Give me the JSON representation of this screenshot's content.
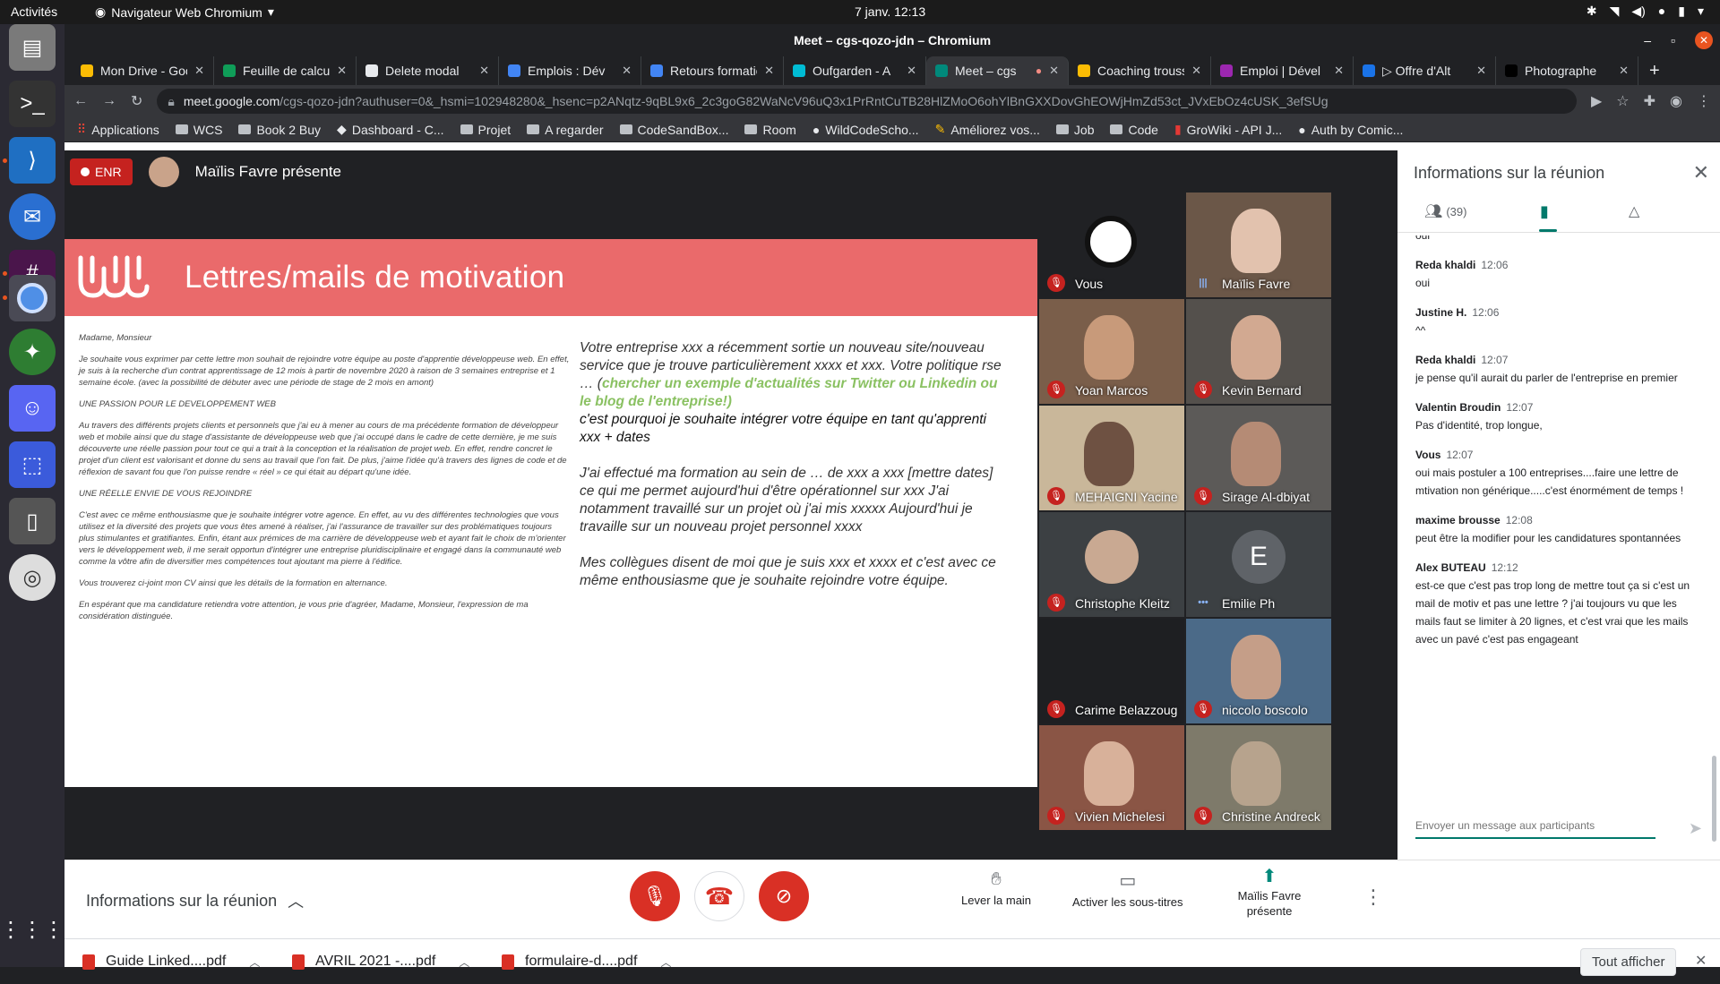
{
  "topbar": {
    "activities": "Activités",
    "app_name": "Navigateur Web Chromium",
    "clock": "7 janv.  12:13"
  },
  "window": {
    "title": "Meet – cgs-qozo-jdn – Chromium"
  },
  "tabs": [
    {
      "label": "Mon Drive - Google",
      "color": "#fbbc04"
    },
    {
      "label": "Feuille de calcul",
      "color": "#0f9d58"
    },
    {
      "label": "Delete modal",
      "color": "#e8eaed"
    },
    {
      "label": "Emplois : Dév",
      "color": "#4285f4"
    },
    {
      "label": "Retours formation",
      "color": "#4285f4"
    },
    {
      "label": "Oufgarden - A",
      "color": "#00bcd4"
    },
    {
      "label": "Meet – cgs",
      "color": "#00897b"
    },
    {
      "label": "Coaching trousse",
      "color": "#fbbc04"
    },
    {
      "label": "Emploi | Dével",
      "color": "#9c27b0"
    },
    {
      "label": "▷ Offre d'Alt",
      "color": "#1a73e8"
    },
    {
      "label": "Photographe",
      "color": "#000000"
    }
  ],
  "address": {
    "host": "meet.google.com",
    "path": "/cgs-qozo-jdn?authuser=0&_hsmi=102948280&_hsenc=p2ANqtz-9qBL9x6_2c3goG82WaNcV96uQ3x1PrRntCuTB28HlZMoO6ohYlBnGXXDovGhEOWjHmZd53ct_JVxEbOz4cUSK_3efSUg"
  },
  "bookmarks": [
    "Applications",
    "WCS",
    "Book 2 Buy",
    "Dashboard - C...",
    "Projet",
    "A regarder",
    "CodeSandBox...",
    "Room",
    "WildCodeScho...",
    "Améliorez vos...",
    "Job",
    "Code",
    "GroWiki - API J...",
    "Auth by Comic..."
  ],
  "recording": {
    "badge": "ENR",
    "presenter": "Maïlis Favre présente"
  },
  "slide": {
    "title": "Lettres/mails de motivation",
    "letter": [
      "Madame, Monsieur",
      "Je souhaite vous exprimer par cette lettre mon souhait de rejoindre votre équipe au poste d'apprentie développeuse web. En effet, je suis à la recherche d'un contrat apprentissage de 12 mois à partir de novembre 2020 à raison de 3 semaines entreprise et 1 semaine école. (avec la possibilité de débuter avec une période de stage de 2 mois en amont)",
      "UNE PASSION POUR LE DEVELOPPEMENT WEB",
      "Au travers des différents projets clients et personnels que j'ai eu à mener au cours de ma précédente formation de développeur web et mobile ainsi que du stage d'assistante de développeuse web que j'ai occupé dans le cadre de cette dernière, je me suis découverte une réelle passion pour tout ce qui a trait à la conception et la réalisation de projet web. En effet, rendre concret le projet d'un client est valorisant et donne du sens au travail que l'on fait. De plus, j'aime l'idée qu'à travers des lignes de code et de réflexion de savant fou que l'on puisse rendre « réel » ce qui était au départ qu'une idée.",
      "UNE RÉELLE ENVIE DE VOUS REJOINDRE",
      "C'est avec ce même enthousiasme que je souhaite intégrer votre agence. En effet, au vu des différentes technologies que vous utilisez et la diversité des projets que vous êtes amené à réaliser, j'ai l'assurance de travailler sur des problématiques toujours plus stimulantes et gratifiantes. Enfin, étant aux prémices de ma carrière de développeuse web et ayant fait le choix de m'orienter vers le développement web, il me serait opportun d'intégrer une entreprise pluridisciplinaire et engagé dans la communauté web comme la vôtre afin de diversifier mes compétences tout ajoutant ma pierre à l'édifice.",
      "Vous trouverez ci-joint mon CV ainsi que les détails de la formation en alternance.",
      "En espérant que ma candidature retiendra votre attention, je vous prie d'agréer, Madame, Monsieur, l'expression de ma considération distinguée."
    ],
    "notes": {
      "p1_a": "Votre entreprise xxx a récemment sortie un nouveau site/nouveau service que je trouve particulièrement xxxx et xxx. Votre politique rse … (",
      "p1_hl": "chercher un exemple d'actualités sur Twitter ou Linkedin ou le blog de l'entreprise!)",
      "p1_b": "c'est pourquoi je souhaite intégrer votre équipe en tant qu'apprenti xxx + dates",
      "p2": "J'ai effectué ma formation au sein de … de xxx a xxx [mettre dates] ce qui me permet aujourd'hui d'être opérationnel sur xxx J'ai notamment travaillé sur un projet où j'ai mis xxxxx Aujourd'hui je travaille sur un nouveau projet personnel xxxx",
      "p3": "Mes collègues disent de moi que je suis xxx et xxxx et c'est avec ce même enthousiasme que je souhaite rejoindre votre équipe."
    }
  },
  "participants": [
    {
      "name": "Vous",
      "type": "logo",
      "bg": "#202124",
      "mic": "muted"
    },
    {
      "name": "Maïlis Favre",
      "type": "video",
      "bg": "#6b5748",
      "head": "#e2c2ae",
      "mic": "talking"
    },
    {
      "name": "Yoan Marcos",
      "type": "video",
      "bg": "#7a5e4a",
      "head": "#c89a7a",
      "mic": "muted"
    },
    {
      "name": "Kevin Bernard",
      "type": "video",
      "bg": "#54504c",
      "head": "#d2a991",
      "mic": "muted"
    },
    {
      "name": "MEHAIGNI Yacine",
      "type": "video",
      "bg": "#c9b79a",
      "head": "#6e5142",
      "mic": "muted"
    },
    {
      "name": "Sirage Al-dbiyat",
      "type": "video",
      "bg": "#5c5a58",
      "head": "#b58b75",
      "mic": "muted"
    },
    {
      "name": "Christophe Kleitz",
      "type": "avatar",
      "bg": "#3c4043",
      "head": "#c9a992",
      "mic": "muted"
    },
    {
      "name": "Emilie Ph",
      "type": "letter",
      "initial": "E",
      "bg": "#3c4043",
      "mic": "dots"
    },
    {
      "name": "Carime Belazzoug",
      "type": "empty",
      "bg": "#1e1f22",
      "mic": "muted"
    },
    {
      "name": "niccolo boscolo",
      "type": "video",
      "bg": "#4b6a88",
      "head": "#c59e88",
      "mic": "muted"
    },
    {
      "name": "Vivien Michelesi",
      "type": "video",
      "bg": "#8a5545",
      "head": "#d8b19a",
      "mic": "muted"
    },
    {
      "name": "Christine Andreck",
      "type": "video",
      "bg": "#7e7a6a",
      "head": "#b7a38d",
      "mic": "muted"
    }
  ],
  "panel": {
    "title": "Informations sur la réunion",
    "people_count": "(39)",
    "messages": [
      {
        "who": "",
        "time": "",
        "text": "oui"
      },
      {
        "who": "Reda khaldi",
        "time": "12:06",
        "text": "oui"
      },
      {
        "who": "Justine H.",
        "time": "12:06",
        "text": "^^"
      },
      {
        "who": "Reda khaldi",
        "time": "12:07",
        "text": "je pense qu'il aurait du parler de l'entreprise en premier"
      },
      {
        "who": "Valentin Broudin",
        "time": "12:07",
        "text": "Pas d'identité, trop longue,"
      },
      {
        "who": "Vous",
        "time": "12:07",
        "text": "oui mais postuler a 100 entreprises....faire une lettre de mtivation non générique.....c'est énormément de temps !"
      },
      {
        "who": "maxime brousse",
        "time": "12:08",
        "text": "peut être la modifier pour les candidatures spontannées"
      },
      {
        "who": "Alex BUTEAU",
        "time": "12:12",
        "text": "est-ce que c'est pas trop long de mettre tout ça si c'est un mail de motiv et pas une lettre ? j'ai toujours vu que les mails faut se limiter à 20 lignes, et c'est vrai que les mails avec un pavé c'est pas engageant"
      }
    ],
    "composer_placeholder": "Envoyer un message aux participants"
  },
  "controls": {
    "meeting_info": "Informations sur la réunion",
    "raise_hand": "Lever la main",
    "captions": "Activer les sous-titres",
    "presenting": "Maïlis Favre présente"
  },
  "downloads": [
    {
      "name": "Guide Linked....pdf"
    },
    {
      "name": "AVRIL 2021 -....pdf"
    },
    {
      "name": "formulaire-d....pdf"
    }
  ],
  "shelf": {
    "show_all": "Tout afficher"
  },
  "colors": {
    "accent": "#00796b",
    "danger": "#d93025",
    "slide_banner": "#ea6a6b"
  }
}
